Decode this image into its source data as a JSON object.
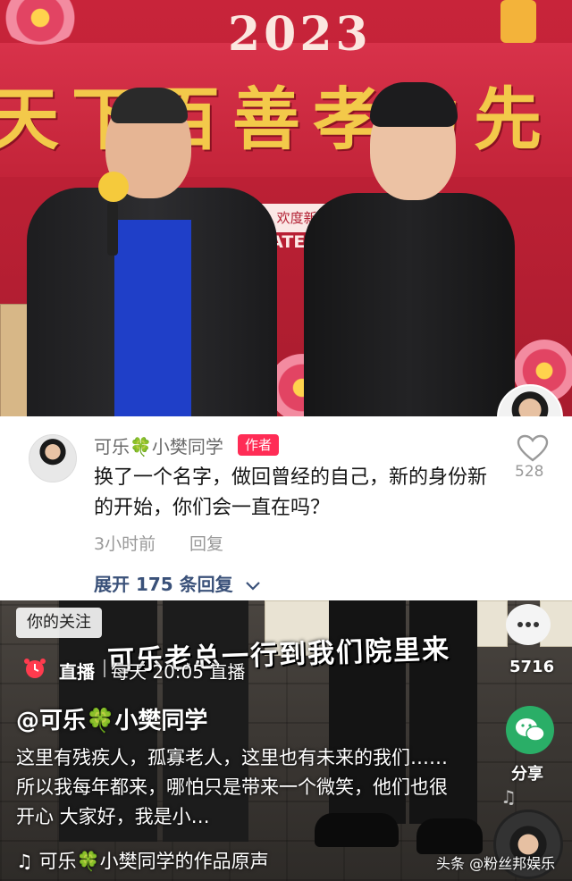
{
  "top_frame": {
    "banner_text": "天下百善孝为先",
    "year_text": "2023",
    "sub_sign": "欢度新春 喜迎",
    "sub_sign_en": "PATE THE"
  },
  "comment": {
    "author_name": "可乐",
    "author_name_suffix": "小樊同学",
    "author_badge": "作者",
    "text": "换了一个名字，做回曾经的自己，新的身份新的开始，你们会一直在吗？",
    "time": "3小时前",
    "reply_label": "回复",
    "expand_label": "展开 175 条回复",
    "like_count": "528"
  },
  "video": {
    "follow_tag": "你的关注",
    "caption": "可乐老总一行到我们院里来",
    "live_label": "直播",
    "live_time": "每天 20:05 直播",
    "author_handle_prefix": "@可乐",
    "author_handle_suffix": "小樊同学",
    "description": "这里有残疾人，孤寡老人，这里也有未来的我们……所以我每年都来，哪怕只是带来一个微笑，他们也很开心 大家好，我是小…",
    "music_prefix": "可乐",
    "music_suffix": "小樊同学的作品原声",
    "comment_count": "5716",
    "share_label": "分享",
    "watermark": "头条 @粉丝邦娱乐",
    "clover_glyph": "🍀",
    "note_glyph": "♫"
  },
  "colors": {
    "author_badge": "#ff2c55",
    "expand_link": "#3a5179",
    "wechat_green": "#2aae67"
  }
}
